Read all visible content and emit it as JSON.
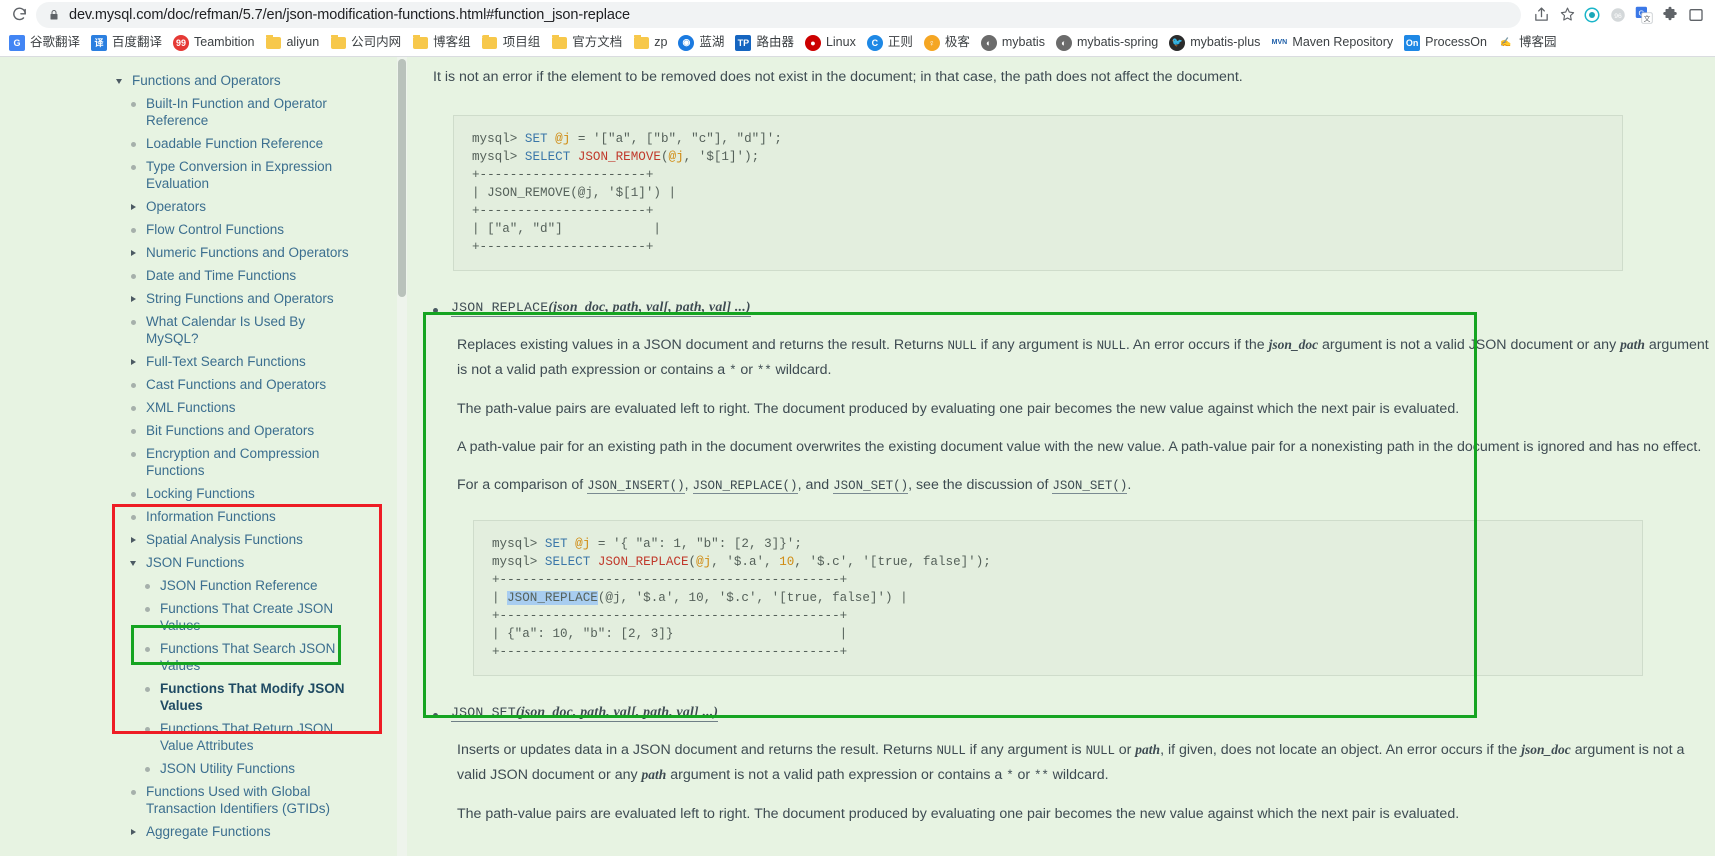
{
  "browser": {
    "url": "dev.mysql.com/doc/refman/5.7/en/json-modification-functions.html#function_json-replace",
    "reload_icon": "reload-icon",
    "lock_icon": "lock-icon",
    "share_icon": "share-icon",
    "bookmark_star_icon": "star-icon",
    "extensions": [
      {
        "name": "extension-circle-icon",
        "glyph": "◎",
        "color": "#19b5c9"
      },
      {
        "name": "extension-gray-icon",
        "glyph": "❋",
        "color": "#c8ccce"
      },
      {
        "name": "google-translate-extension-icon",
        "glyph": "G",
        "color": "#3b78e7"
      },
      {
        "name": "extensions-puzzle-icon",
        "glyph": "🧩",
        "color": "#5f6368"
      },
      {
        "name": "profile-avatar-icon",
        "glyph": "▭",
        "color": "#5f6368"
      }
    ]
  },
  "bookmarks": [
    {
      "label": "谷歌翻译",
      "icon": "google-translate-icon",
      "glyph": "G",
      "bg": "#4285f4",
      "fg": "#ffffff",
      "type": "square"
    },
    {
      "label": "百度翻译",
      "icon": "baidu-translate-icon",
      "glyph": "译",
      "bg": "#2b7fe0",
      "fg": "#ffffff",
      "type": "square"
    },
    {
      "label": "Teambition",
      "icon": "teambition-icon",
      "glyph": "99",
      "bg": "#e53935",
      "fg": "#ffffff",
      "type": "round"
    },
    {
      "label": "aliyun",
      "icon": "folder-icon",
      "glyph": "",
      "bg": "",
      "fg": "",
      "type": "folder"
    },
    {
      "label": "公司内网",
      "icon": "folder-icon",
      "glyph": "",
      "bg": "",
      "fg": "",
      "type": "folder"
    },
    {
      "label": "博客组",
      "icon": "folder-icon",
      "glyph": "",
      "bg": "",
      "fg": "",
      "type": "folder"
    },
    {
      "label": "项目组",
      "icon": "folder-icon",
      "glyph": "",
      "bg": "",
      "fg": "",
      "type": "folder"
    },
    {
      "label": "官方文档",
      "icon": "folder-icon",
      "glyph": "",
      "bg": "",
      "fg": "",
      "type": "folder"
    },
    {
      "label": "zp",
      "icon": "folder-icon",
      "glyph": "",
      "bg": "",
      "fg": "",
      "type": "folder"
    },
    {
      "label": "蓝湖",
      "icon": "lanhu-icon",
      "glyph": "◉",
      "bg": "#1b7ae0",
      "fg": "#ffffff",
      "type": "round"
    },
    {
      "label": "路由器",
      "icon": "tp-link-router-icon",
      "glyph": "TP",
      "bg": "#1565c0",
      "fg": "#ffffff",
      "type": "square"
    },
    {
      "label": "Linux",
      "icon": "linux-redhat-icon",
      "glyph": "●",
      "bg": "#cc0000",
      "fg": "#ffffff",
      "type": "round"
    },
    {
      "label": "正则",
      "icon": "regex-icon",
      "glyph": "C",
      "bg": "#1e88e5",
      "fg": "#ffffff",
      "type": "round"
    },
    {
      "label": "极客",
      "icon": "geek-icon",
      "glyph": "♀",
      "bg": "#f5a623",
      "fg": "#ffffff",
      "type": "round"
    },
    {
      "label": "mybatis",
      "icon": "mybatis-icon",
      "glyph": "◐",
      "bg": "#6b6b6b",
      "fg": "#ffffff",
      "type": "round"
    },
    {
      "label": "mybatis-spring",
      "icon": "mybatis-spring-icon",
      "glyph": "◐",
      "bg": "#6b6b6b",
      "fg": "#ffffff",
      "type": "round"
    },
    {
      "label": "mybatis-plus",
      "icon": "mybatis-plus-icon",
      "glyph": "🐦",
      "bg": "#2b2b2b",
      "fg": "#ffffff",
      "type": "round"
    },
    {
      "label": "Maven Repository",
      "icon": "maven-icon",
      "glyph": "MVN",
      "bg": "#ffffff",
      "fg": "#1f5fa8",
      "type": "square"
    },
    {
      "label": "ProcessOn",
      "icon": "processon-icon",
      "glyph": "On",
      "bg": "#1e88e5",
      "fg": "#ffffff",
      "type": "square"
    },
    {
      "label": "博客园",
      "icon": "cnblogs-icon",
      "glyph": "✍",
      "bg": "#ffffff",
      "fg": "#1f5fa8",
      "type": "square"
    }
  ],
  "sidebar": {
    "items": [
      {
        "label": "Functions and Operators",
        "level": 1,
        "marker": "caret-down",
        "active": false
      },
      {
        "label": "Built-In Function and Operator Reference",
        "level": 2,
        "marker": "dot",
        "active": false
      },
      {
        "label": "Loadable Function Reference",
        "level": 2,
        "marker": "dot",
        "active": false
      },
      {
        "label": "Type Conversion in Expression Evaluation",
        "level": 2,
        "marker": "dot",
        "active": false
      },
      {
        "label": "Operators",
        "level": 2,
        "marker": "caret-right",
        "active": false
      },
      {
        "label": "Flow Control Functions",
        "level": 2,
        "marker": "dot",
        "active": false
      },
      {
        "label": "Numeric Functions and Operators",
        "level": 2,
        "marker": "caret-right",
        "active": false
      },
      {
        "label": "Date and Time Functions",
        "level": 2,
        "marker": "dot",
        "active": false
      },
      {
        "label": "String Functions and Operators",
        "level": 2,
        "marker": "caret-right",
        "active": false
      },
      {
        "label": "What Calendar Is Used By MySQL?",
        "level": 2,
        "marker": "dot",
        "active": false
      },
      {
        "label": "Full-Text Search Functions",
        "level": 2,
        "marker": "caret-right",
        "active": false
      },
      {
        "label": "Cast Functions and Operators",
        "level": 2,
        "marker": "dot",
        "active": false
      },
      {
        "label": "XML Functions",
        "level": 2,
        "marker": "dot",
        "active": false
      },
      {
        "label": "Bit Functions and Operators",
        "level": 2,
        "marker": "dot",
        "active": false
      },
      {
        "label": "Encryption and Compression Functions",
        "level": 2,
        "marker": "dot",
        "active": false
      },
      {
        "label": "Locking Functions",
        "level": 2,
        "marker": "dot",
        "active": false
      },
      {
        "label": "Information Functions",
        "level": 2,
        "marker": "dot",
        "active": false
      },
      {
        "label": "Spatial Analysis Functions",
        "level": 2,
        "marker": "caret-right",
        "active": false
      },
      {
        "label": "JSON Functions",
        "level": 2,
        "marker": "caret-down",
        "active": false
      },
      {
        "label": "JSON Function Reference",
        "level": 3,
        "marker": "dot",
        "active": false
      },
      {
        "label": "Functions That Create JSON Values",
        "level": 3,
        "marker": "dot",
        "active": false
      },
      {
        "label": "Functions That Search JSON Values",
        "level": 3,
        "marker": "dot",
        "active": false
      },
      {
        "label": "Functions That Modify JSON Values",
        "level": 3,
        "marker": "dot",
        "active": true
      },
      {
        "label": "Functions That Return JSON Value Attributes",
        "level": 3,
        "marker": "dot",
        "active": false
      },
      {
        "label": "JSON Utility Functions",
        "level": 3,
        "marker": "dot",
        "active": false
      },
      {
        "label": "Functions Used with Global Transaction Identifiers (GTIDs)",
        "level": 2,
        "marker": "dot",
        "active": false
      },
      {
        "label": "Aggregate Functions",
        "level": 2,
        "marker": "caret-right",
        "active": false
      }
    ]
  },
  "annotations": {
    "red_box_color": "#ee1c25",
    "green_box_color": "#15a421"
  },
  "content": {
    "top_note": "It is not an error if the element to be removed does not exist in the document; in that case, the path does not affect the document.",
    "json_remove_code": [
      {
        "segs": [
          {
            "t": "mysql> ",
            "c": "str"
          },
          {
            "t": "SET ",
            "c": "kw"
          },
          {
            "t": "@j",
            "c": "var"
          },
          {
            "t": " = '[\"a\", [\"b\", \"c\"], \"d\"]';",
            "c": "str"
          }
        ]
      },
      {
        "segs": [
          {
            "t": "mysql> ",
            "c": "str"
          },
          {
            "t": "SELECT ",
            "c": "kw"
          },
          {
            "t": "JSON_REMOVE",
            "c": "fn"
          },
          {
            "t": "(",
            "c": "str"
          },
          {
            "t": "@j",
            "c": "var"
          },
          {
            "t": ", '$[1]');",
            "c": "str"
          }
        ]
      },
      {
        "segs": [
          {
            "t": "+----------------------+",
            "c": "str"
          }
        ]
      },
      {
        "segs": [
          {
            "t": "| JSON_REMOVE(@j, '$[1]') |",
            "c": "str"
          }
        ]
      },
      {
        "segs": [
          {
            "t": "+----------------------+",
            "c": "str"
          }
        ]
      },
      {
        "segs": [
          {
            "t": "| [\"a\", \"d\"]            |",
            "c": "str"
          }
        ]
      },
      {
        "segs": [
          {
            "t": "+----------------------+",
            "c": "str"
          }
        ]
      }
    ],
    "json_replace": {
      "signature_name": "JSON_REPLACE",
      "signature_args": "(json_doc, path, val[, path, val] ...)",
      "p1_a": "Replaces existing values in a JSON document and returns the result. Returns ",
      "p1_null1": "NULL",
      "p1_b": " if any argument is ",
      "p1_null2": "NULL",
      "p1_c": ". An error occurs if the ",
      "p1_jsondoc": "json_doc",
      "p1_d": " argument is not a valid JSON document or any ",
      "p1_path": "path",
      "p1_e": " argument is not a valid path expression or contains a ",
      "p1_star": "*",
      "p1_f": " or ",
      "p1_dstar": "**",
      "p1_g": " wildcard.",
      "p2": "The path-value pairs are evaluated left to right. The document produced by evaluating one pair becomes the new value against which the next pair is evaluated.",
      "p3": "A path-value pair for an existing path in the document overwrites the existing document value with the new value. A path-value pair for a nonexisting path in the document is ignored and has no effect.",
      "p4_a": "For a comparison of ",
      "p4_x1": "JSON_INSERT()",
      "p4_b": ", ",
      "p4_x2": "JSON_REPLACE()",
      "p4_c": ", and ",
      "p4_x3": "JSON_SET()",
      "p4_d": ", see the discussion of ",
      "p4_x4": "JSON_SET()",
      "p4_e": ".",
      "code": [
        {
          "segs": [
            {
              "t": "mysql> ",
              "c": "str"
            },
            {
              "t": "SET ",
              "c": "kw"
            },
            {
              "t": "@j",
              "c": "var"
            },
            {
              "t": " = '{ \"a\": 1, \"b\": [2, 3]}';",
              "c": "str"
            }
          ]
        },
        {
          "segs": [
            {
              "t": "mysql> ",
              "c": "str"
            },
            {
              "t": "SELECT ",
              "c": "kw"
            },
            {
              "t": "JSON_REPLACE",
              "c": "fn"
            },
            {
              "t": "(",
              "c": "str"
            },
            {
              "t": "@j",
              "c": "var"
            },
            {
              "t": ", '$.a', ",
              "c": "str"
            },
            {
              "t": "10",
              "c": "num"
            },
            {
              "t": ", '$.c', '[true, false]');",
              "c": "str"
            }
          ]
        },
        {
          "segs": [
            {
              "t": "+---------------------------------------------+",
              "c": "str"
            }
          ]
        },
        {
          "segs": [
            {
              "t": "| ",
              "c": "str"
            },
            {
              "t": "JSON_REPLACE",
              "c": "sel"
            },
            {
              "t": "(@j, '$.a', 10, '$.c', '[true, false]') |",
              "c": "str"
            }
          ]
        },
        {
          "segs": [
            {
              "t": "+---------------------------------------------+",
              "c": "str"
            }
          ]
        },
        {
          "segs": [
            {
              "t": "| {\"a\": 10, \"b\": [2, 3]}                      |",
              "c": "str"
            }
          ]
        },
        {
          "segs": [
            {
              "t": "+---------------------------------------------+",
              "c": "str"
            }
          ]
        }
      ]
    },
    "json_set": {
      "signature_name": "JSON_SET",
      "signature_args": "(json_doc, path, val[, path, val] ...)",
      "p1_a": "Inserts or updates data in a JSON document and returns the result. Returns ",
      "p1_null1": "NULL",
      "p1_b": " if any argument is ",
      "p1_null2": "NULL",
      "p1_c": " or ",
      "p1_path0": "path",
      "p1_d": ", if given, does not locate an object. An error occurs if the ",
      "p1_jsondoc": "json_doc",
      "p1_e": " argument is not a valid JSON document or any ",
      "p1_path": "path",
      "p1_f": " argument is not a valid path expression or contains a ",
      "p1_star": "*",
      "p1_g": " or ",
      "p1_dstar": "**",
      "p1_h": " wildcard.",
      "p2": "The path-value pairs are evaluated left to right. The document produced by evaluating one pair becomes the new value against which the next pair is evaluated."
    }
  }
}
